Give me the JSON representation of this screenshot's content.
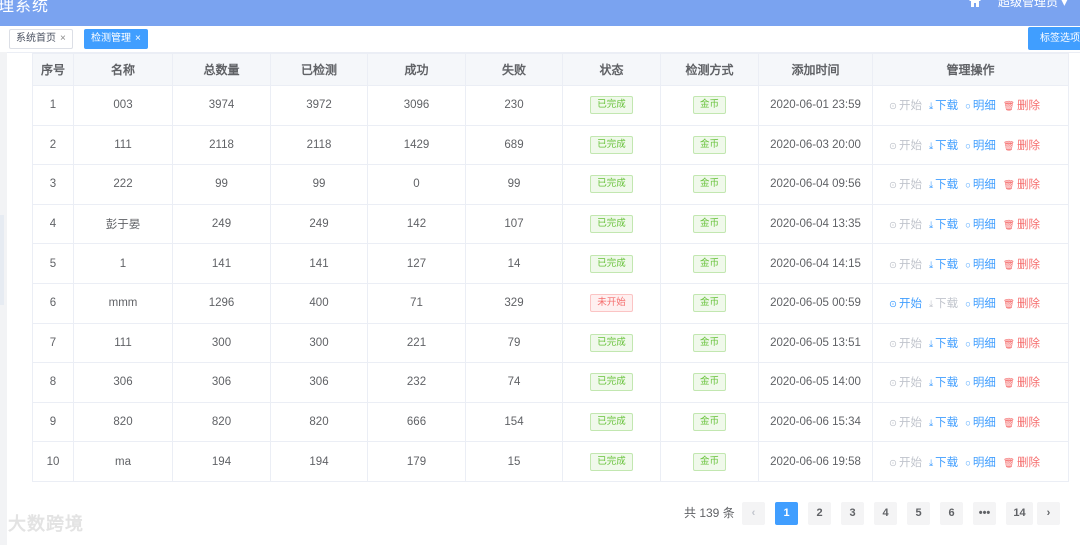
{
  "app": {
    "title": "理系统",
    "user": "超级管理员 ▾"
  },
  "tabs": [
    {
      "label": "系统首页",
      "close": "×",
      "active": false
    },
    {
      "label": "检测管理",
      "close": "×",
      "active": true
    }
  ],
  "tag_options_label": "标签选项",
  "table": {
    "headers": [
      "序号",
      "名称",
      "总数量",
      "已检测",
      "成功",
      "失败",
      "状态",
      "检测方式",
      "添加时间",
      "管理操作"
    ],
    "actions": {
      "start": "开始",
      "download": "下载",
      "detail": "明细",
      "delete": "删除"
    },
    "rows": [
      {
        "no": "1",
        "name": "003",
        "total": "3974",
        "checked": "3972",
        "success": "3096",
        "fail": "230",
        "status": "已完成",
        "method": "金币",
        "time": "2020-06-01 23:59",
        "started": true
      },
      {
        "no": "2",
        "name": "111",
        "total": "2118",
        "checked": "2118",
        "success": "1429",
        "fail": "689",
        "status": "已完成",
        "method": "金币",
        "time": "2020-06-03 20:00",
        "started": true
      },
      {
        "no": "3",
        "name": "222",
        "total": "99",
        "checked": "99",
        "success": "0",
        "fail": "99",
        "status": "已完成",
        "method": "金币",
        "time": "2020-06-04 09:56",
        "started": true
      },
      {
        "no": "4",
        "name": "彭于晏",
        "total": "249",
        "checked": "249",
        "success": "142",
        "fail": "107",
        "status": "已完成",
        "method": "金币",
        "time": "2020-06-04 13:35",
        "started": true
      },
      {
        "no": "5",
        "name": "1",
        "total": "141",
        "checked": "141",
        "success": "127",
        "fail": "14",
        "status": "已完成",
        "method": "金币",
        "time": "2020-06-04 14:15",
        "started": true
      },
      {
        "no": "6",
        "name": "mmm",
        "total": "1296",
        "checked": "400",
        "success": "71",
        "fail": "329",
        "status": "未开始",
        "method": "金币",
        "time": "2020-06-05 00:59",
        "started": false
      },
      {
        "no": "7",
        "name": "111",
        "total": "300",
        "checked": "300",
        "success": "221",
        "fail": "79",
        "status": "已完成",
        "method": "金币",
        "time": "2020-06-05 13:51",
        "started": true
      },
      {
        "no": "8",
        "name": "306",
        "total": "306",
        "checked": "306",
        "success": "232",
        "fail": "74",
        "status": "已完成",
        "method": "金币",
        "time": "2020-06-05 14:00",
        "started": true
      },
      {
        "no": "9",
        "name": "820",
        "total": "820",
        "checked": "820",
        "success": "666",
        "fail": "154",
        "status": "已完成",
        "method": "金币",
        "time": "2020-06-06 15:34",
        "started": true
      },
      {
        "no": "10",
        "name": "ma",
        "total": "194",
        "checked": "194",
        "success": "179",
        "fail": "15",
        "status": "已完成",
        "method": "金币",
        "time": "2020-06-06 19:58",
        "started": true
      }
    ]
  },
  "pagination": {
    "total_text": "共 139 条",
    "prev": "‹",
    "next": "›",
    "pages": [
      "1",
      "2",
      "3",
      "4",
      "5",
      "6",
      "•••",
      "14"
    ],
    "current": "1"
  },
  "watermark": "大数跨境",
  "colors": {
    "primary": "#409eff",
    "success": "#67c23a",
    "danger": "#f56c6c",
    "header": "#7aa3f0"
  }
}
